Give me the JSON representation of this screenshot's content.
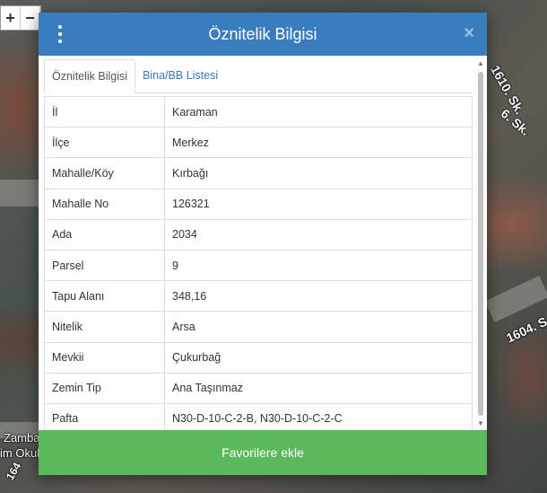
{
  "map": {
    "zoom_in": "+",
    "zoom_out": "−",
    "street_1": "1610. Sk.",
    "street_2": "6. Sk.",
    "street_3": "1604. S",
    "place_1": "Zamba",
    "place_2": "im Okul",
    "place_3": "164"
  },
  "modal": {
    "title": "Öznitelik Bilgisi",
    "close": "×",
    "tabs": [
      {
        "label": "Öznitelik Bilgisi",
        "active": true
      },
      {
        "label": "Bina/BB Listesi",
        "active": false
      }
    ],
    "rows": [
      {
        "key": "İl",
        "value": "Karaman"
      },
      {
        "key": "İlçe",
        "value": "Merkez"
      },
      {
        "key": "Mahalle/Köy",
        "value": "Kırbağı"
      },
      {
        "key": "Mahalle No",
        "value": "126321"
      },
      {
        "key": "Ada",
        "value": "2034"
      },
      {
        "key": "Parsel",
        "value": "9"
      },
      {
        "key": "Tapu Alanı",
        "value": "348,16"
      },
      {
        "key": "Nitelik",
        "value": "Arsa"
      },
      {
        "key": "Mevkii",
        "value": "Çukurbağ"
      },
      {
        "key": "Zemin Tip",
        "value": "Ana Taşınmaz"
      },
      {
        "key": "Pafta",
        "value": "N30-D-10-C-2-B, N30-D-10-C-2-C"
      }
    ],
    "favorite_button": "Favorilere ekle"
  },
  "colors": {
    "header": "#3a7dbf",
    "button": "#5cb85c",
    "tab_link": "#337ab7"
  }
}
